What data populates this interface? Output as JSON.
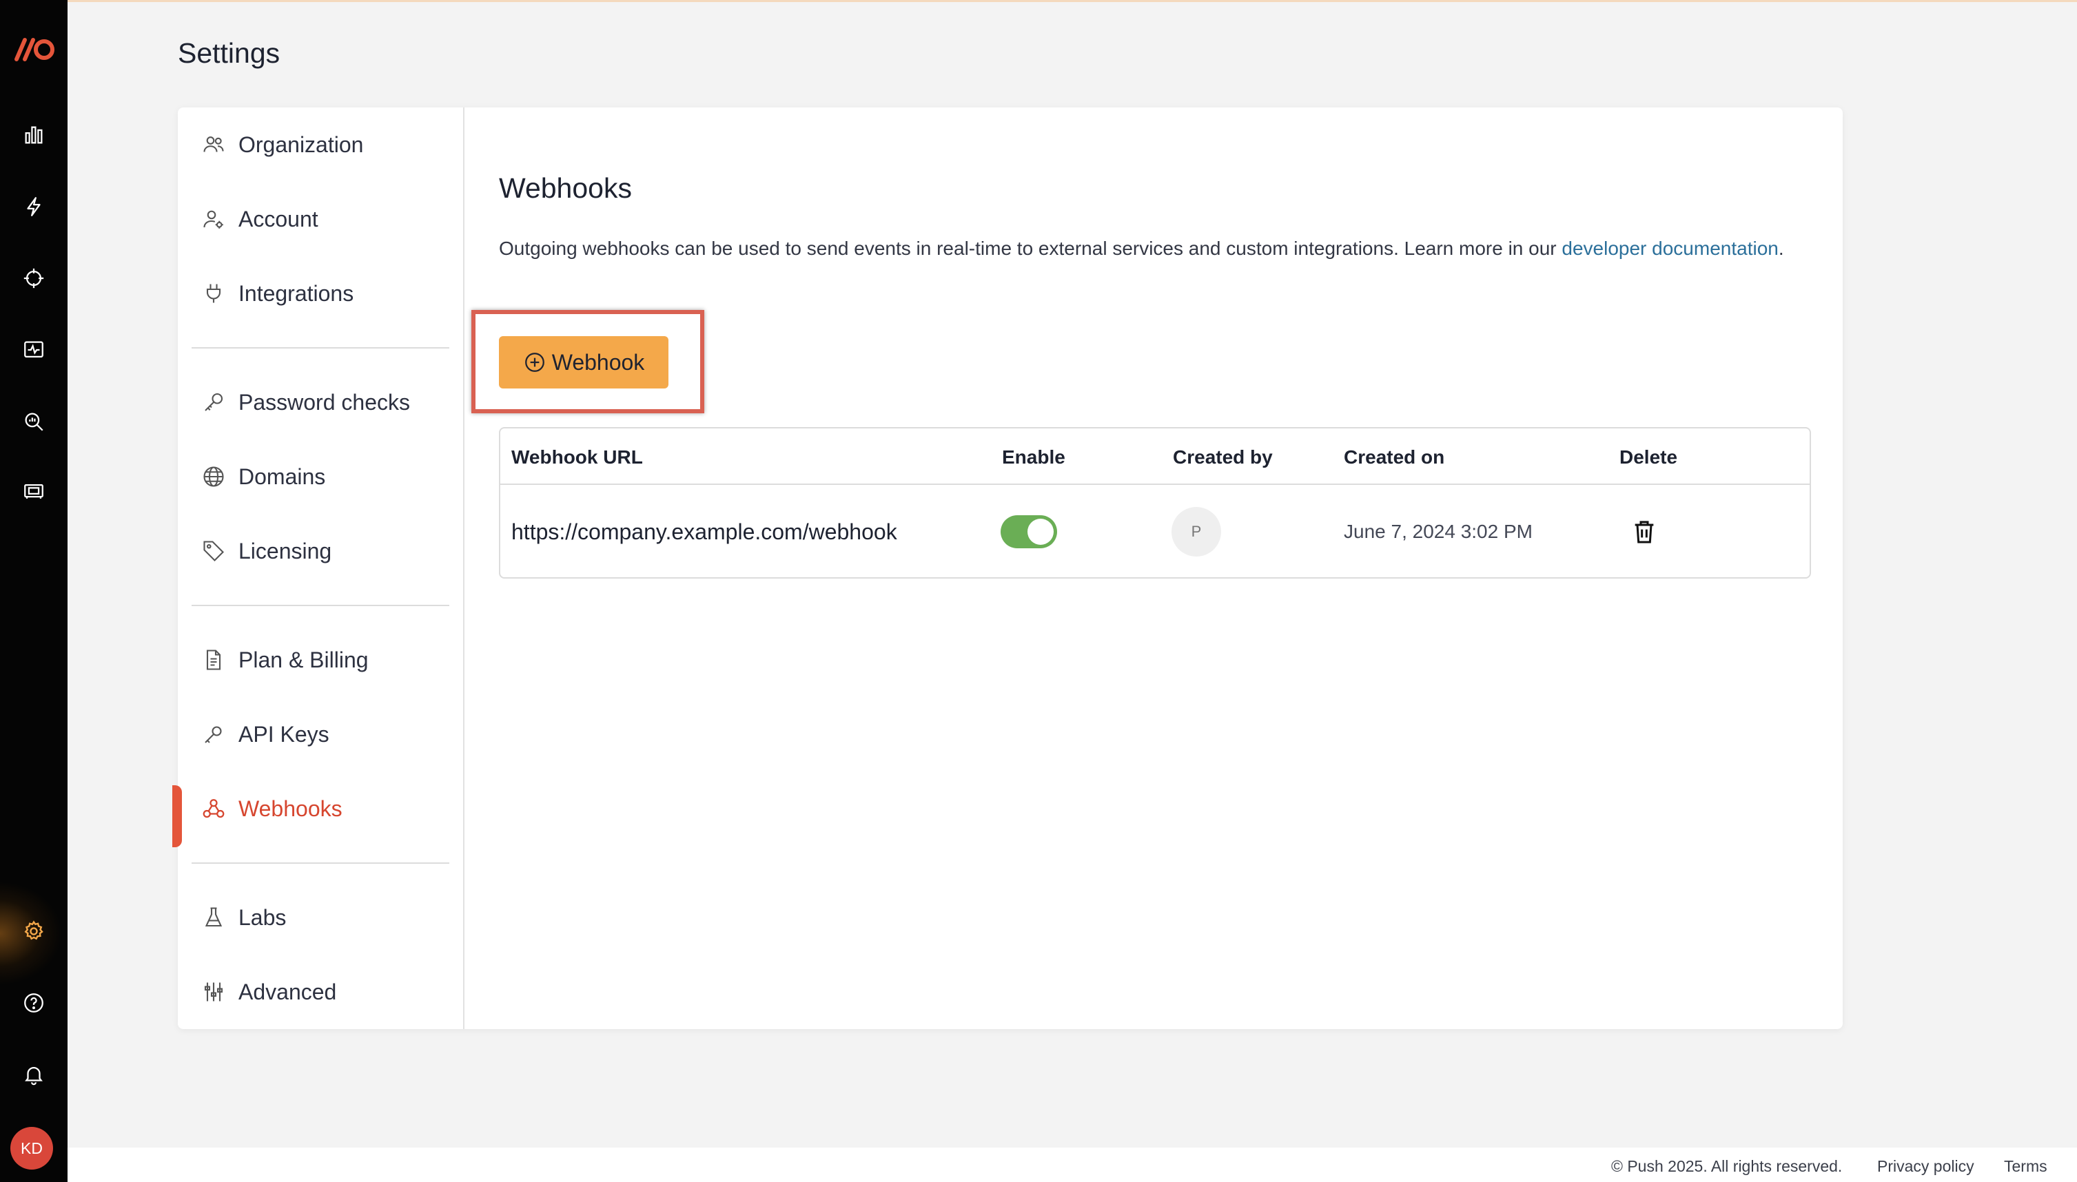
{
  "page": {
    "title": "Settings"
  },
  "rail": {
    "icons": [
      "bar-chart-icon",
      "lightning-icon",
      "crosshair-icon",
      "activity-monitor-icon",
      "search-chart-icon",
      "film-card-icon",
      "gear-icon",
      "help-icon",
      "bell-icon"
    ],
    "user_initials": "KD",
    "active_icon": "gear-icon",
    "active_color": "#f4a84a"
  },
  "settings_nav": {
    "groups": [
      [
        {
          "label": "Organization",
          "icon": "users-icon"
        },
        {
          "label": "Account",
          "icon": "user-gear-icon"
        },
        {
          "label": "Integrations",
          "icon": "plug-icon"
        }
      ],
      [
        {
          "label": "Password checks",
          "icon": "key-icon"
        },
        {
          "label": "Domains",
          "icon": "globe-icon"
        },
        {
          "label": "Licensing",
          "icon": "tag-icon"
        }
      ],
      [
        {
          "label": "Plan & Billing",
          "icon": "document-icon"
        },
        {
          "label": "API Keys",
          "icon": "api-key-icon"
        },
        {
          "label": "Webhooks",
          "icon": "webhook-icon",
          "active": true
        }
      ],
      [
        {
          "label": "Labs",
          "icon": "flask-icon"
        },
        {
          "label": "Advanced",
          "icon": "sliders-icon"
        }
      ]
    ],
    "active_color": "#d6462f"
  },
  "webhooks": {
    "heading": "Webhooks",
    "description": "Outgoing webhooks can be used to send events in real-time to external services and custom integrations. Learn more in our ",
    "description_link": "developer documentation",
    "description_end": ".",
    "add_button_label": "Webhook",
    "table": {
      "columns": [
        "Webhook URL",
        "Enable",
        "Created by",
        "Created on",
        "Delete"
      ],
      "rows": [
        {
          "url": "https://company.example.com/webhook",
          "enabled": true,
          "created_by": "P",
          "created_on": "June 7, 2024 3:02 PM"
        }
      ]
    }
  },
  "footer": {
    "copyright": "© Push 2025. All rights reserved.",
    "privacy": "Privacy policy",
    "terms": "Terms"
  }
}
